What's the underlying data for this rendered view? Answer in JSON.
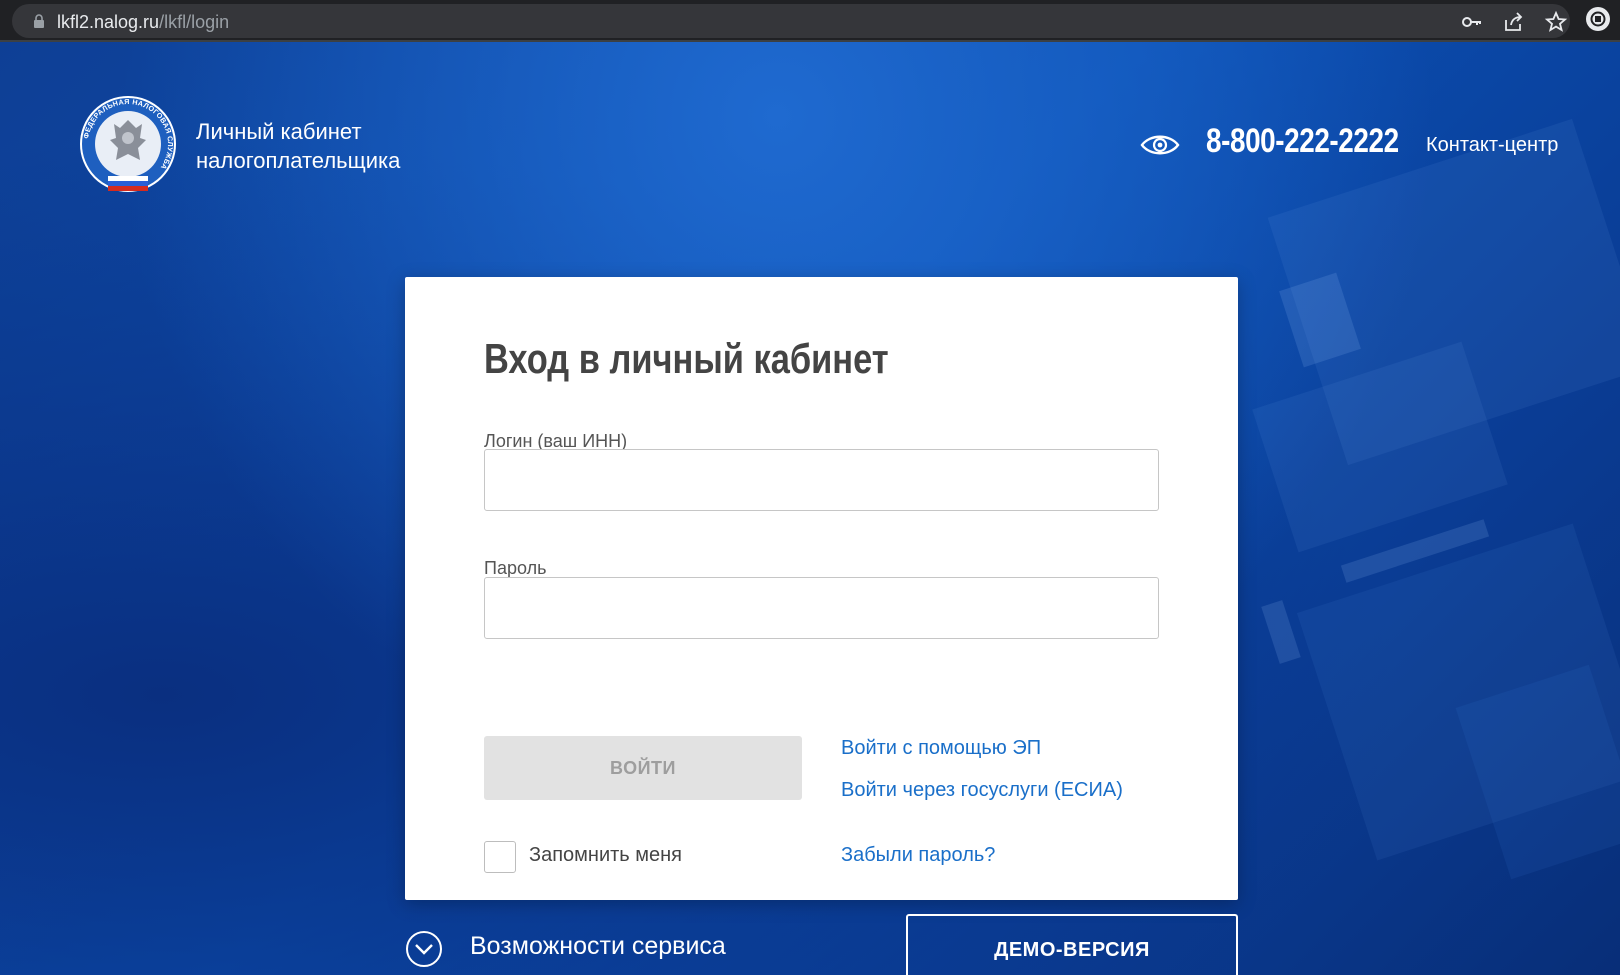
{
  "browser": {
    "url_host": "lkfl2.nalog.ru",
    "url_path": "/lkfl/login",
    "icons": [
      "lock-icon",
      "key-icon",
      "share-icon",
      "star-icon",
      "extension-icon"
    ]
  },
  "header": {
    "brand_line1": "Личный кабинет",
    "brand_line2": "налогоплательщика",
    "logo_ring_text": "ФЕДЕРАЛЬНАЯ НАЛОГОВАЯ СЛУЖБА",
    "phone": "8-800-222-2222",
    "contact_center": "Контакт-центр"
  },
  "form": {
    "title": "Вход в личный кабинет",
    "login_label": "Логин (ваш ИНН)",
    "login_value": "",
    "password_label": "Пароль",
    "password_value": "",
    "submit_label": "ВОЙТИ",
    "ep_link": "Войти с помощью ЭП",
    "esia_link": "Войти через госуслуги (ЕСИА)",
    "remember_label": "Запомнить меня",
    "remember_checked": false,
    "forgot_link": "Забыли пароль?"
  },
  "footer": {
    "features_label": "Возможности сервиса",
    "demo_label": "ДЕМО-ВЕРСИЯ"
  },
  "colors": {
    "page_blue": "#0b4fb3",
    "link_blue": "#1a6fc9",
    "button_disabled": "#e2e2e2"
  }
}
